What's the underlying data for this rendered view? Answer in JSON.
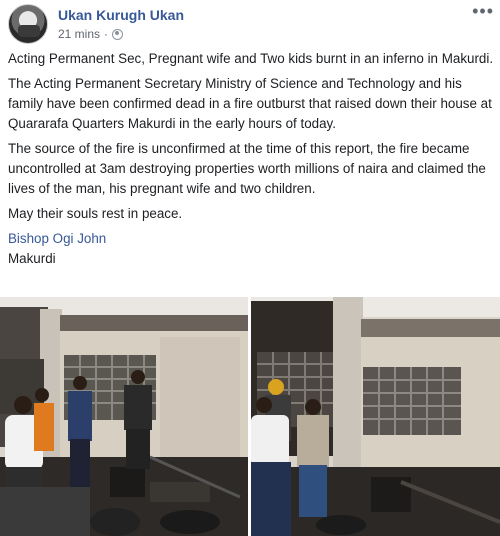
{
  "post": {
    "author": "Ukan Kurugh Ukan",
    "time": "21 mins",
    "separator": "·",
    "more_icon": "more-dots-icon",
    "audience_icon": "globe-icon",
    "paragraphs": [
      "Acting Permanent Sec, Pregnant wife and Two kids burnt in an inferno in Makurdi.",
      "The Acting Permanent Secretary Ministry of Science and Technology and his family have been confirmed dead in a fire outburst that raised down their house at Quararafa Quarters Makurdi in the early hours of today.",
      "The source of the fire is unconfirmed at the time of this report, the fire became uncontrolled at 3am destroying properties worth millions of naira and claimed the lives of the man, his pregnant wife and two children.",
      "May their souls rest in peace."
    ],
    "tag_name": "Bishop Ogi John",
    "location": "Makurdi"
  },
  "colors": {
    "link": "#385898",
    "text": "#1c1e21",
    "meta": "#606770"
  }
}
